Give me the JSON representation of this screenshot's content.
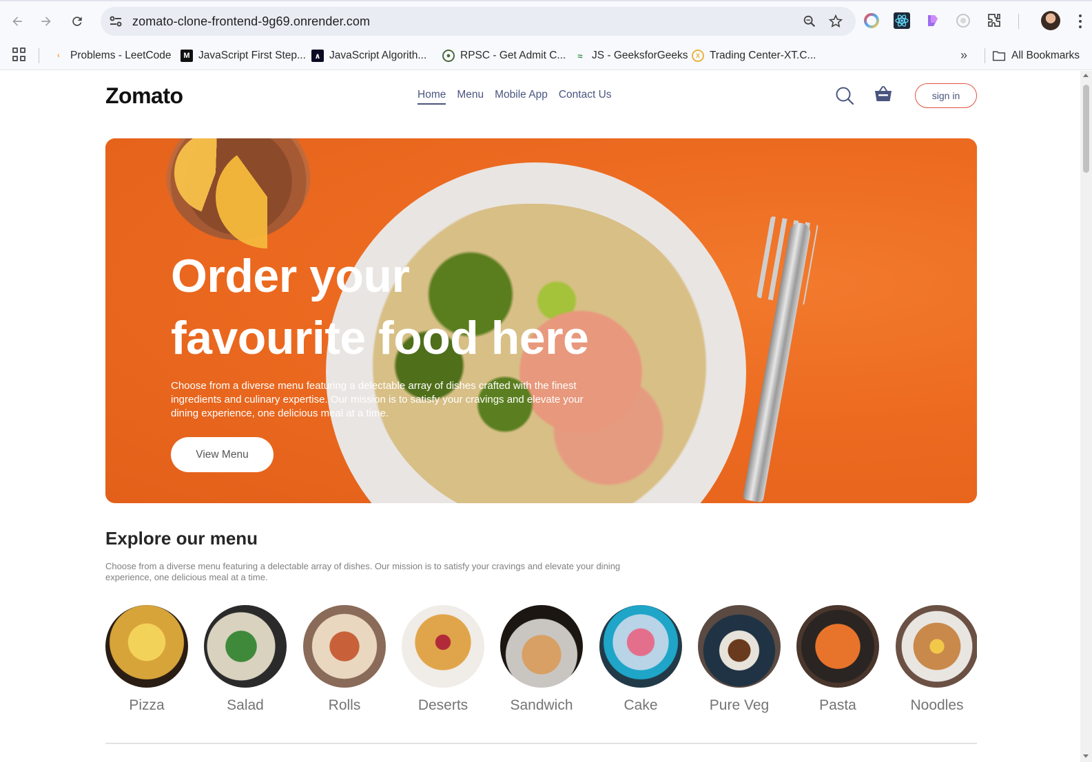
{
  "browser": {
    "url": "zomato-clone-frontend-9g69.onrender.com",
    "bookmarks": [
      {
        "label": "Problems - LeetCode",
        "icon": "leetcode-icon"
      },
      {
        "label": "JavaScript First Step...",
        "icon": "mdn-icon"
      },
      {
        "label": "JavaScript Algorith...",
        "icon": "freecodecamp-icon"
      },
      {
        "label": "RPSC - Get Admit C...",
        "icon": "rpsc-icon"
      },
      {
        "label": "JS - GeeksforGeeks",
        "icon": "gfg-icon"
      },
      {
        "label": "Trading Center-XT.C...",
        "icon": "xt-icon"
      }
    ],
    "more_bookmarks": "»",
    "all_bookmarks": "All Bookmarks"
  },
  "navbar": {
    "logo": "Zomato",
    "menu": [
      "Home",
      "Menu",
      "Mobile App",
      "Contact Us"
    ],
    "active_menu": "Home",
    "sign_in": "sign in"
  },
  "hero": {
    "title_line1": "Order your",
    "title_line2": "favourite food here",
    "description": "Choose from a diverse menu featuring a delectable array of dishes crafted with the finest ingredients and culinary expertise. Our mission is to satisfy your cravings and elevate your dining experience, one delicious meal at a time.",
    "button": "View Menu"
  },
  "explore": {
    "title": "Explore our menu",
    "description": "Choose from a diverse menu featuring a delectable array of dishes. Our mission is to satisfy your cravings and elevate your dining experience, one delicious meal at a time.",
    "categories": [
      "Pizza",
      "Salad",
      "Rolls",
      "Deserts",
      "Sandwich",
      "Cake",
      "Pure Veg",
      "Pasta",
      "Noodles"
    ]
  },
  "colors": {
    "accent": "#e0533e",
    "hero_bg": "#ee6b22",
    "nav_text": "#49557e"
  }
}
